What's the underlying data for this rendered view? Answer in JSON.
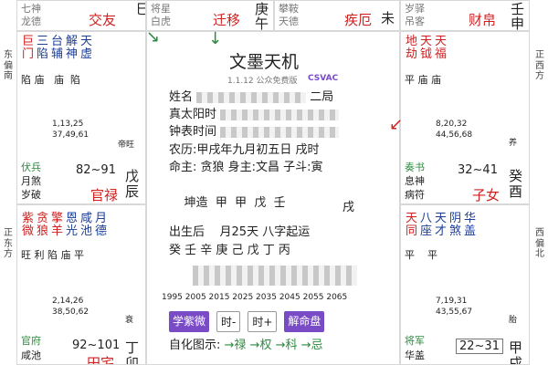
{
  "sides": {
    "left_top": "东偏南",
    "left_mid": "正东方",
    "right_top": "正西方",
    "right_mid": "西偏北"
  },
  "top_row": {
    "c1": {
      "l1": "七神",
      "l2": "龙德",
      "star": "交友"
    },
    "c2": {
      "s1": "巳",
      "s2": "巳"
    },
    "c3": {
      "l1": "将星",
      "l2": "白虎",
      "star": "迁移",
      "palace": "午",
      "s1": "庚"
    },
    "c4": {
      "l1": "攀鞍",
      "l2": "天德",
      "star": "疾厄",
      "s1": "未"
    },
    "c5": {
      "l1": "岁驿",
      "l2": "吊客",
      "star": "财帛",
      "s1": "壬",
      "s2": "申"
    }
  },
  "left_palace_1": {
    "stars": [
      "巨门",
      "三陷",
      "台辅",
      "解神",
      "天虚"
    ],
    "status": "陷 庙   庙  陷",
    "ages": [
      "1,13,25",
      "37,49,61"
    ],
    "emperor": "帝旺",
    "bottom1": "伏兵",
    "bottom2": "月煞",
    "bottom3": "岁破",
    "range": "82~91",
    "palace": "官禄",
    "branch": "戊辰"
  },
  "left_palace_2": {
    "stars": [
      "紫微",
      "贪狼",
      "擎羊",
      "恩光",
      "咸池",
      "月德"
    ],
    "status": "旺 利 陷 庙 平",
    "ages": [
      "2,14,26",
      "38,50,62"
    ],
    "emperor": "衰",
    "bottom1": "官府",
    "bottom2": "咸池",
    "range": "92~101",
    "palace": "田宅",
    "branch": "丁卯"
  },
  "right_palace_1": {
    "stars": [
      "地劫",
      "天钺",
      "天福"
    ],
    "status": "平 庙 庙",
    "ages": [
      "8,20,32",
      "44,56,68"
    ],
    "emperor": "养",
    "bottom1": "奏书",
    "bottom2": "息神",
    "bottom3": "病符",
    "range": "32~41",
    "palace": "子女",
    "branch": "癸酉"
  },
  "right_palace_2": {
    "stars": [
      "天同",
      "八座",
      "天才",
      "阴煞",
      "华盖"
    ],
    "status": "平    平",
    "ages": [
      "7,19,31",
      "43,55,67"
    ],
    "emperor": "胎",
    "bottom1": "将军",
    "bottom2": "华盖",
    "range": "22~31",
    "palace": "",
    "branch": "甲戌"
  },
  "center": {
    "title": "文墨天机",
    "version": "1.1.12 公众免费版",
    "brand": "CSVAC",
    "name_label": "姓名",
    "name_suffix": "二局",
    "solar_label": "真太阳时",
    "clock_label": "钟表时间",
    "lunar_line": "农历:甲戌年九月初五日 戌时",
    "lord_line": "命主: 贪狼 身主:文昌 子斗:寅",
    "qian_label": "坤造",
    "qian_chars": "甲  甲  戊  壬",
    "qian_chars2": "戌",
    "birth_line": "出生后    月25天 八字起运",
    "ganzhi_line": "癸 壬 辛 庚 己 戊 丁 丙",
    "years": "1995 2005 2015 2025 2035 2045 2055 2065",
    "btn1": "学紫微",
    "btn2": "时-",
    "btn3": "时+",
    "btn4": "解命盘",
    "hua_label": "自化图示:",
    "hua_items": "→禄 →权 →科 →忌"
  }
}
